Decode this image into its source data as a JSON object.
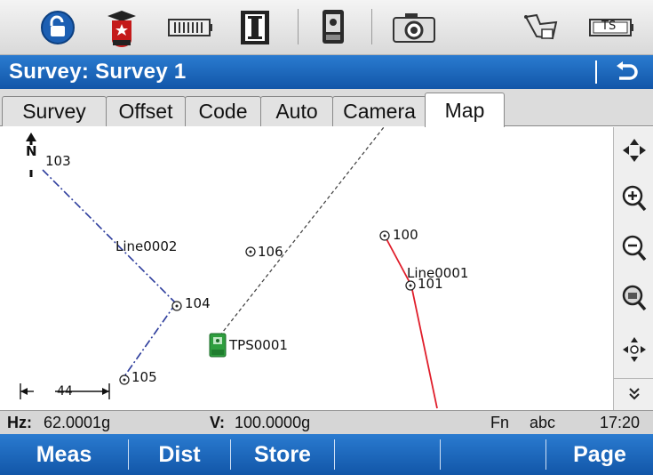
{
  "toolbar": {
    "icons": [
      "unlock-icon",
      "graduate-icon",
      "battery-icon",
      "i-block-icon",
      "total-station-icon",
      "camera-icon",
      "polyline-icon",
      "ts-icon"
    ],
    "ts_label": "TS"
  },
  "header": {
    "title": "Survey: Survey 1"
  },
  "tabs": [
    {
      "label": "Survey"
    },
    {
      "label": "Offset"
    },
    {
      "label": "Code"
    },
    {
      "label": "Auto"
    },
    {
      "label": "Camera"
    },
    {
      "label": "Map"
    }
  ],
  "active_tab": "Map",
  "map": {
    "north_label": "N",
    "scale_label": "44",
    "points": [
      {
        "id": "103",
        "label": "103"
      },
      {
        "id": "104",
        "label": "104"
      },
      {
        "id": "105",
        "label": "105"
      },
      {
        "id": "106",
        "label": "106"
      },
      {
        "id": "100",
        "label": "100"
      },
      {
        "id": "101",
        "label": "101"
      }
    ],
    "lines": [
      {
        "label": "Line0002"
      },
      {
        "label": "Line0001"
      }
    ],
    "station": {
      "label": "TPS0001"
    }
  },
  "status": {
    "hz_label": "Hz:",
    "hz_value": "62.0001g",
    "v_label": "V:",
    "v_value": "100.0000g",
    "fn": "Fn",
    "mode": "abc",
    "time": "17:20"
  },
  "softkeys": [
    {
      "label": "Meas"
    },
    {
      "label": "Dist"
    },
    {
      "label": "Store"
    },
    {
      "label": ""
    },
    {
      "label": ""
    },
    {
      "label": "Page"
    }
  ],
  "colors": {
    "accent": "#1a66bd",
    "red_line": "#e01d2a",
    "blue_line": "#2c3c9c",
    "station_green": "#2e9e3e"
  }
}
